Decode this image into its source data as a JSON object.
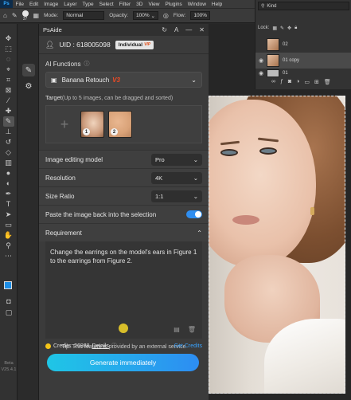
{
  "menubar": {
    "logo": "Ps",
    "items": [
      "File",
      "Edit",
      "Image",
      "Layer",
      "Type",
      "Select",
      "Filter",
      "3D",
      "View",
      "Plugins",
      "Window",
      "Help"
    ]
  },
  "options": {
    "brush_size": "37",
    "mode_label": "Mode:",
    "mode_value": "Normal",
    "opacity_label": "Opacity:",
    "opacity_value": "100%",
    "flow_label": "Flow:",
    "flow_value": "100%"
  },
  "layers": {
    "search_value": "Kind",
    "lock_label": "Lock:",
    "rows": [
      {
        "name": "02"
      },
      {
        "name": "01 copy"
      },
      {
        "name": "01"
      }
    ]
  },
  "toolbar": {
    "version_line1": "Beta",
    "version_line2": "V25.4.1"
  },
  "colors": {
    "foreground": "#1d8ee6",
    "background": "#111111",
    "accent": "#2d8df2",
    "v3": "#f04a24"
  },
  "psaide": {
    "title": "PsAide",
    "uid": "UID : 618005098",
    "plan": "Individual",
    "plan_tag": "VIP",
    "ai_functions_label": "AI Functions",
    "ai_function_value": "Banana Retouch",
    "ai_function_version": "V3",
    "target_label": "Target",
    "target_hint": "(Up to 5 images, can be dragged and sorted)",
    "thumbs": [
      {
        "num": "1"
      },
      {
        "num": "2"
      }
    ],
    "model_label": "Image editing model",
    "model_value": "Pro",
    "resolution_label": "Resolution",
    "resolution_value": "4K",
    "size_ratio_label": "Size Ratio",
    "size_ratio_value": "1:1",
    "paste_back_label": "Paste the image back into the selection",
    "paste_back_on": true,
    "requirement_label": "Requirement",
    "requirement_text": "Change the earrings on the model's ears in Figure 1 to the earrings from Figure 2.",
    "tip": "Tip: This feature is provided by an external service",
    "credits_label": "Credits: 26988",
    "details_label": "Details",
    "get_credits_label": "Get Credits",
    "generate_label": "Generate immediately"
  }
}
